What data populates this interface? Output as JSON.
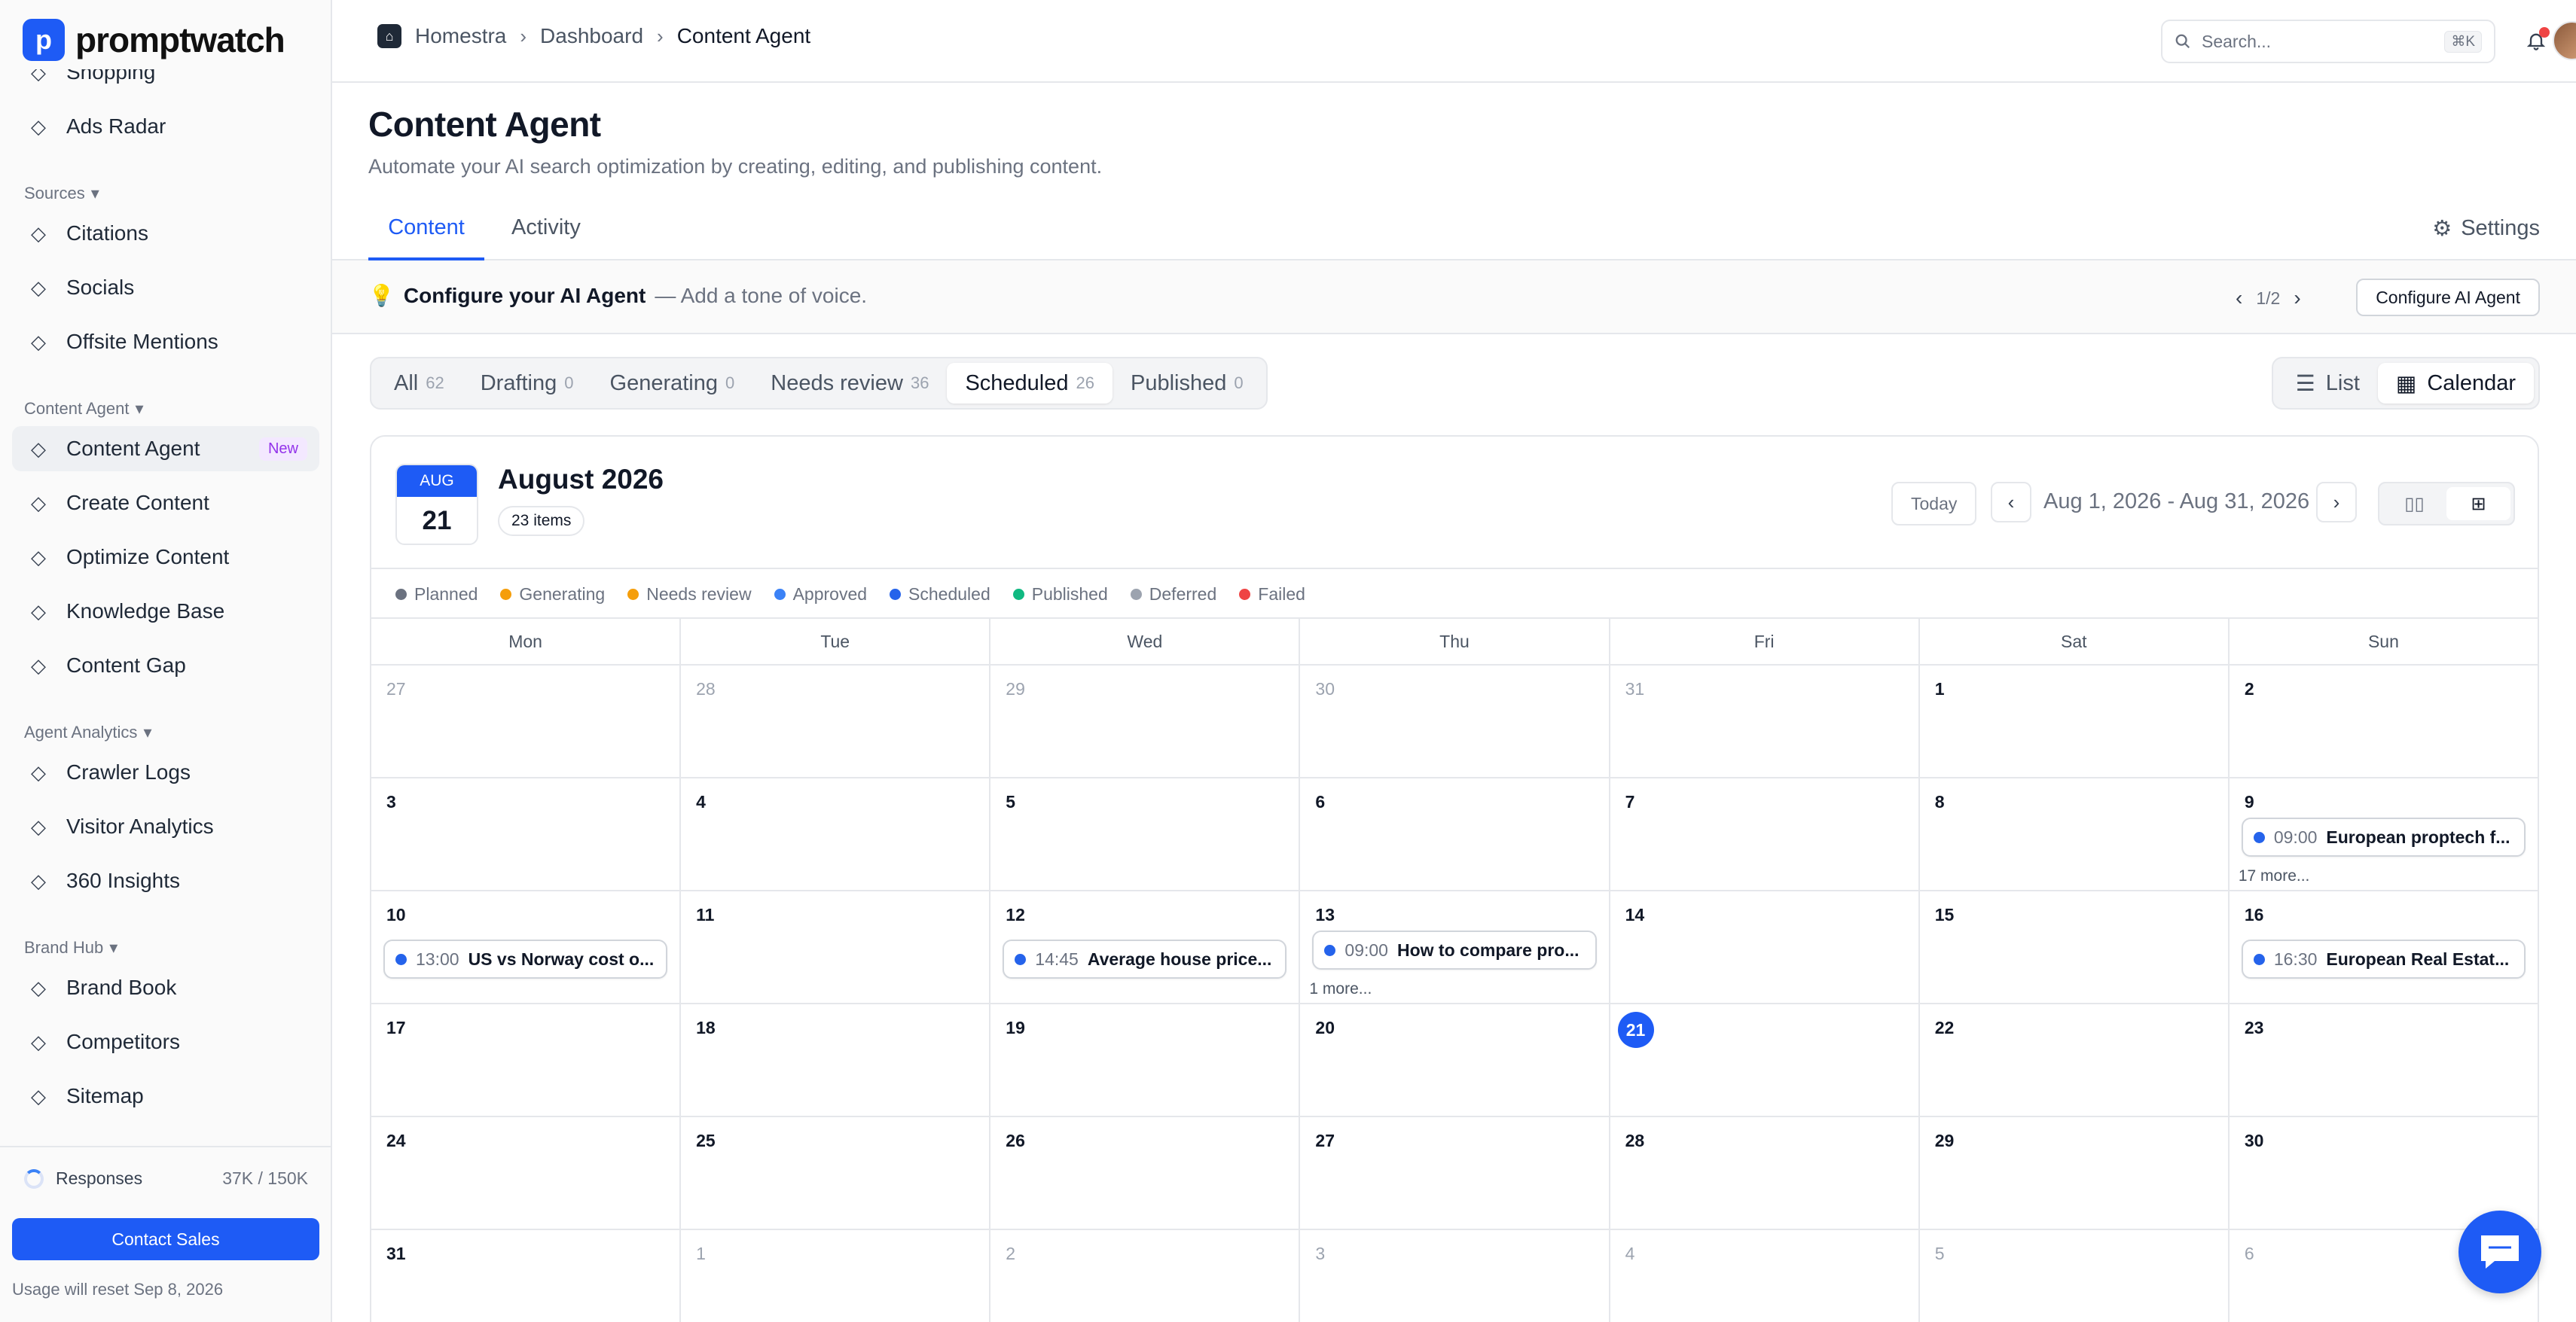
{
  "app": {
    "name": "promptwatch"
  },
  "sidebar": {
    "items": [
      {
        "label": "Shopping",
        "icon": "cart-icon"
      },
      {
        "label": "Ads Radar",
        "icon": "megaphone-icon"
      },
      {
        "section": "Sources"
      },
      {
        "label": "Citations",
        "icon": "quote-icon"
      },
      {
        "label": "Socials",
        "icon": "users-icon"
      },
      {
        "label": "Offsite Mentions",
        "icon": "nodes-icon"
      },
      {
        "section": "Content Agent"
      },
      {
        "label": "Content Agent",
        "icon": "sparkle-icon",
        "badge": "New",
        "active": true
      },
      {
        "label": "Create Content",
        "icon": "document-icon"
      },
      {
        "label": "Optimize Content",
        "icon": "image-icon"
      },
      {
        "label": "Knowledge Base",
        "icon": "brain-icon"
      },
      {
        "label": "Content Gap",
        "icon": "puzzle-icon"
      },
      {
        "section": "Agent Analytics"
      },
      {
        "label": "Crawler Logs",
        "icon": "robot-icon"
      },
      {
        "label": "Visitor Analytics",
        "icon": "chart-line-icon"
      },
      {
        "label": "360 Insights",
        "icon": "broadcast-icon"
      },
      {
        "section": "Brand Hub"
      },
      {
        "label": "Brand Book",
        "icon": "book-icon"
      },
      {
        "label": "Competitors",
        "icon": "rocket-icon"
      },
      {
        "label": "Sitemap",
        "icon": "sitemap-icon"
      }
    ],
    "usage": {
      "label": "Responses",
      "value": "37K / 150K",
      "fraction": 0.25
    },
    "contact_label": "Contact Sales",
    "reset_text": "Usage will reset Sep 8, 2026"
  },
  "topbar": {
    "breadcrumb": [
      "Homestra",
      "Dashboard",
      "Content Agent"
    ],
    "search_placeholder": "Search...",
    "search_shortcut": "⌘K"
  },
  "page": {
    "title": "Content Agent",
    "subtitle": "Automate your AI search optimization by creating, editing, and publishing content.",
    "tabs": [
      "Content",
      "Activity"
    ],
    "settings_label": "Settings"
  },
  "banner": {
    "title": "Configure your AI Agent",
    "text": "— Add a tone of voice.",
    "pager": "1/2",
    "button": "Configure AI Agent"
  },
  "filters": [
    {
      "label": "All",
      "count": "62"
    },
    {
      "label": "Drafting",
      "count": "0"
    },
    {
      "label": "Generating",
      "count": "0"
    },
    {
      "label": "Needs review",
      "count": "36"
    },
    {
      "label": "Scheduled",
      "count": "26",
      "active": true
    },
    {
      "label": "Published",
      "count": "0"
    }
  ],
  "view_toggle": {
    "list": "List",
    "calendar": "Calendar"
  },
  "calendar": {
    "badge_month": "AUG",
    "badge_day": "21",
    "title": "August 2026",
    "count": "23 items",
    "today_label": "Today",
    "range": "Aug 1, 2026 - Aug 31, 2026",
    "legend": [
      {
        "label": "Planned",
        "color": "#6b7280"
      },
      {
        "label": "Generating",
        "color": "#f59e0b"
      },
      {
        "label": "Needs review",
        "color": "#f59e0b"
      },
      {
        "label": "Approved",
        "color": "#3b82f6"
      },
      {
        "label": "Scheduled",
        "color": "#2563eb"
      },
      {
        "label": "Published",
        "color": "#10b981"
      },
      {
        "label": "Deferred",
        "color": "#9ca3af"
      },
      {
        "label": "Failed",
        "color": "#ef4444"
      }
    ],
    "weekdays": [
      "Mon",
      "Tue",
      "Wed",
      "Thu",
      "Fri",
      "Sat",
      "Sun"
    ],
    "weeks": [
      [
        {
          "d": "27",
          "m": true
        },
        {
          "d": "28",
          "m": true
        },
        {
          "d": "29",
          "m": true
        },
        {
          "d": "30",
          "m": true
        },
        {
          "d": "31",
          "m": true
        },
        {
          "d": "1"
        },
        {
          "d": "2"
        }
      ],
      [
        {
          "d": "3"
        },
        {
          "d": "4"
        },
        {
          "d": "5"
        },
        {
          "d": "6"
        },
        {
          "d": "7"
        },
        {
          "d": "8"
        },
        {
          "d": "9",
          "time": "09:00",
          "title": "European proptech f...",
          "more": "17 more..."
        }
      ],
      [
        {
          "d": "10",
          "time": "13:00",
          "title": "US vs Norway cost o..."
        },
        {
          "d": "11"
        },
        {
          "d": "12",
          "time": "14:45",
          "title": "Average house price..."
        },
        {
          "d": "13",
          "time": "09:00",
          "title": "How to compare pro...",
          "more": "1 more..."
        },
        {
          "d": "14"
        },
        {
          "d": "15"
        },
        {
          "d": "16",
          "time": "16:30",
          "title": "European Real Estat..."
        }
      ],
      [
        {
          "d": "17"
        },
        {
          "d": "18"
        },
        {
          "d": "19"
        },
        {
          "d": "20"
        },
        {
          "d": "21",
          "today": true
        },
        {
          "d": "22"
        },
        {
          "d": "23"
        }
      ],
      [
        {
          "d": "24"
        },
        {
          "d": "25"
        },
        {
          "d": "26"
        },
        {
          "d": "27"
        },
        {
          "d": "28"
        },
        {
          "d": "29"
        },
        {
          "d": "30"
        }
      ],
      [
        {
          "d": "31"
        },
        {
          "d": "1",
          "m": true
        },
        {
          "d": "2",
          "m": true
        },
        {
          "d": "3",
          "m": true
        },
        {
          "d": "4",
          "m": true
        },
        {
          "d": "5",
          "m": true
        },
        {
          "d": "6",
          "m": true
        }
      ]
    ]
  }
}
